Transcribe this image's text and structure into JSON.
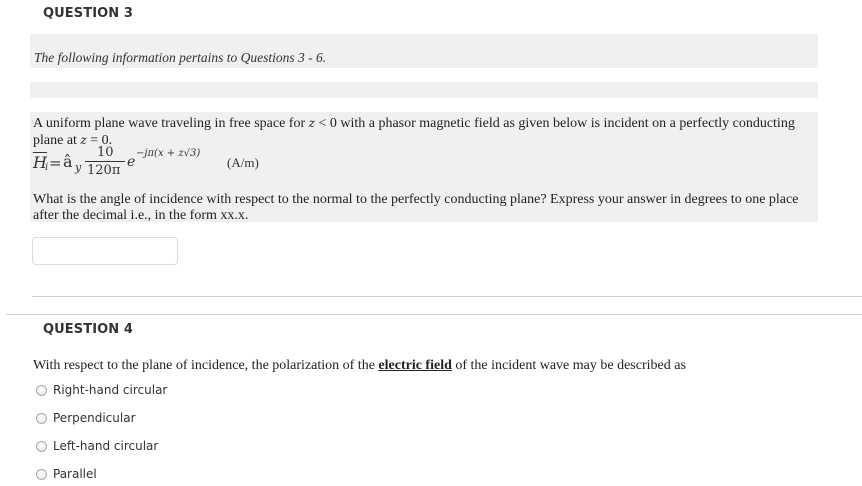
{
  "q3": {
    "heading": "QUESTION 3",
    "intro": "The following information pertains to Questions 3 - 6.",
    "body_line1": "A uniform plane wave traveling in free space for ",
    "body_z": "z",
    "body_line1b": " < 0 with a phasor magnetic field as given below is incident on a perfectly conducting",
    "body_line2a": "plane at ",
    "body_line2z": "z",
    "body_line2b": " = 0.",
    "eq_lhs": "H",
    "eq_sub": "i",
    "eq_eq": " = ",
    "eq_ahat": "â",
    "eq_y": "y",
    "eq_num": "10",
    "eq_den": "120π",
    "eq_e": "e",
    "eq_exp": "−jπ(x + z√3)",
    "eq_unit": "(A/m)",
    "prompt_line1": "What is the angle of incidence with respect to the normal to the perfectly conducting plane? Express your answer in degrees to one place",
    "prompt_line2": "after the decimal i.e., in the form xx.x.",
    "answer_value": ""
  },
  "q4": {
    "heading": "QUESTION 4",
    "text_a": "With respect to the plane of incidence, the polarization of the ",
    "text_b": "electric field",
    "text_c": " of the incident wave may be described as",
    "options": [
      "Right-hand circular",
      "Perpendicular",
      "Left-hand circular",
      "Parallel"
    ]
  },
  "colors": {
    "band": "#f0f0f0",
    "divider": "#cfcfcf",
    "text": "#333333"
  }
}
